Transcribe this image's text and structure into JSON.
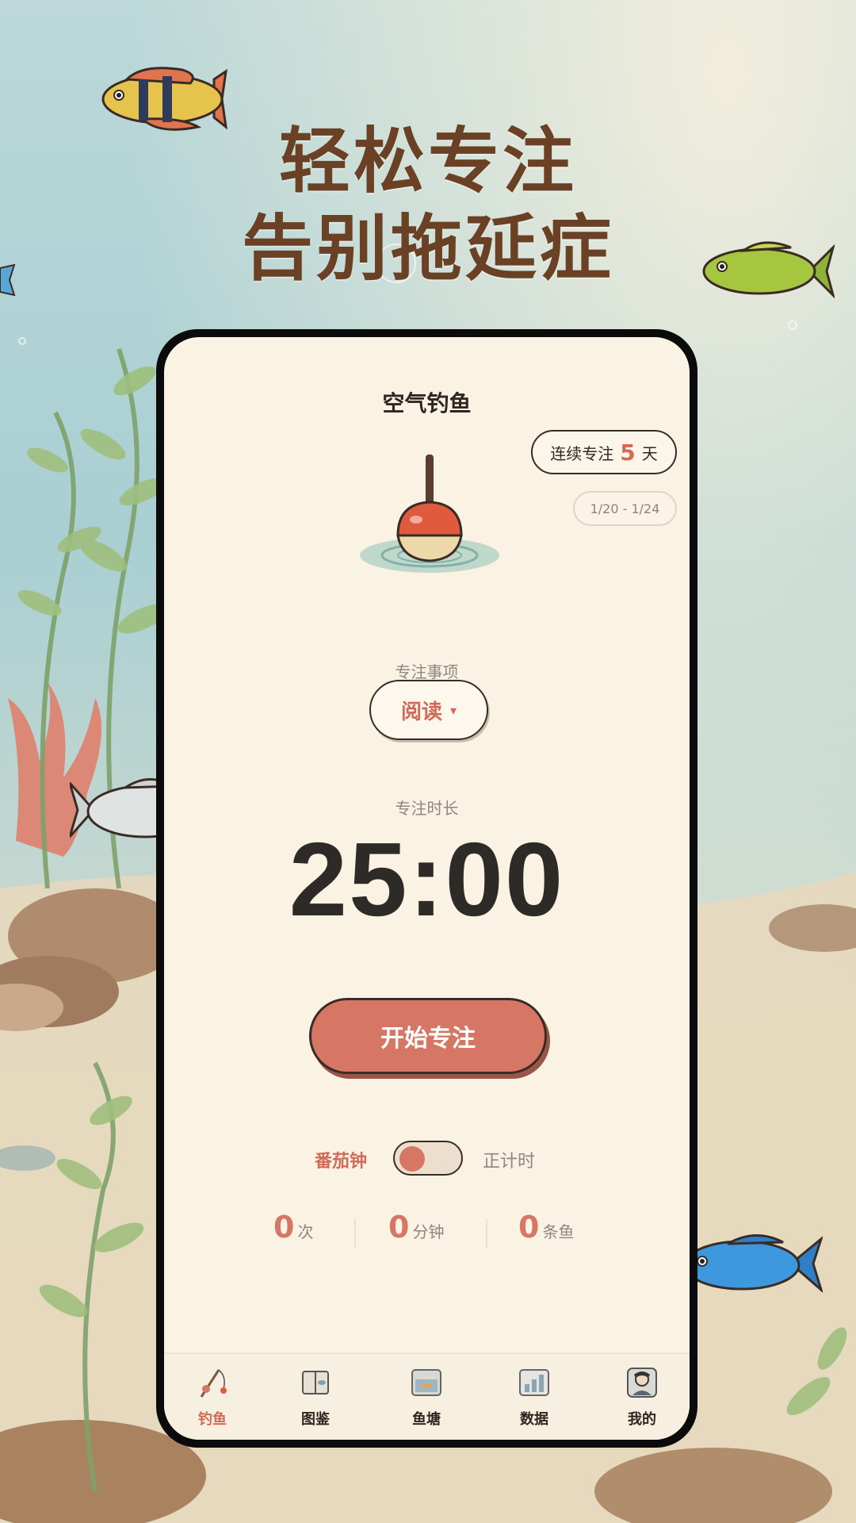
{
  "headline": {
    "line1": "轻松专注",
    "line2": "告别拖延症"
  },
  "app": {
    "title": "空气钓鱼",
    "streak": {
      "prefix": "连续专注",
      "days": "5",
      "suffix": "天"
    },
    "date_range": "1/20 - 1/24",
    "task": {
      "label": "专注事项",
      "value": "阅读",
      "dropdown_glyph": "▾"
    },
    "duration": {
      "label": "专注时长",
      "value": "25:00"
    },
    "start_button": "开始专注",
    "mode": {
      "left": "番茄钟",
      "right": "正计时",
      "toggle_on_left": true
    },
    "stats": [
      {
        "value": "0",
        "unit": "次"
      },
      {
        "value": "0",
        "unit": "分钟"
      },
      {
        "value": "0",
        "unit": "条鱼"
      }
    ],
    "tabs": [
      {
        "label": "钓鱼",
        "icon": "fishing-rod-icon",
        "active": true
      },
      {
        "label": "图鉴",
        "icon": "book-icon",
        "active": false
      },
      {
        "label": "鱼塘",
        "icon": "pond-icon",
        "active": false
      },
      {
        "label": "数据",
        "icon": "chart-icon",
        "active": false
      },
      {
        "label": "我的",
        "icon": "avatar-icon",
        "active": false
      }
    ]
  },
  "colors": {
    "accent": "#d67766",
    "headline": "#6a4124",
    "screen_bg": "#faf2e3",
    "timer": "#2d2a28"
  }
}
